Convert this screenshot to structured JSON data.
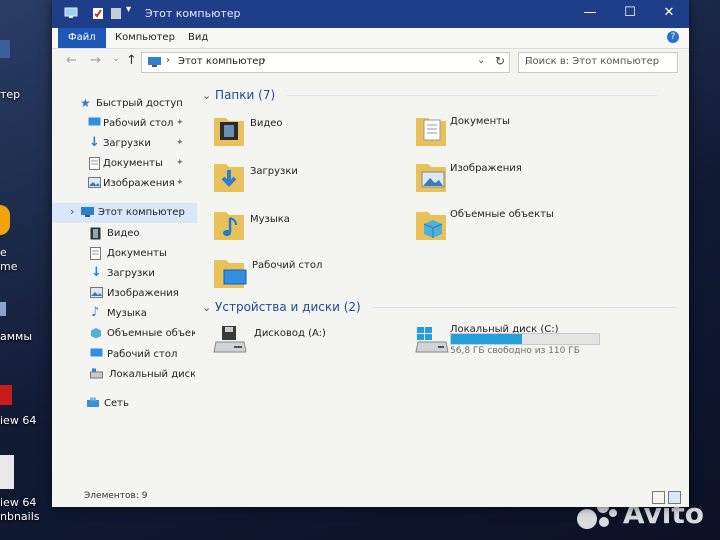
{
  "window": {
    "title": "Этот компьютер",
    "ribbon_tabs": [
      "Файл",
      "Компьютер",
      "Вид"
    ],
    "help": "?",
    "controls": {
      "minimize": "—",
      "maximize": "☐",
      "close": "✕"
    }
  },
  "toolbar": {
    "back": "←",
    "forward": "→",
    "history": "⌄",
    "up": "↑",
    "address": "Этот компьютер",
    "address_sep": "›",
    "address_dropdown": "⌄",
    "refresh": "↻",
    "search_placeholder": "Поиск в: Этот компьютер",
    "search_icon": "⌕"
  },
  "nav": {
    "quick_access": "Быстрый доступ",
    "quick_items": [
      "Рабочий стол",
      "Загрузки",
      "Документы",
      "Изображения"
    ],
    "this_pc": "Этот компьютер",
    "pc_items": [
      "Видео",
      "Документы",
      "Загрузки",
      "Изображения",
      "Музыка",
      "Объемные объекты",
      "Рабочий стол",
      "Локальный диск (C"
    ],
    "network": "Сеть",
    "chevron_collapsed": "›",
    "pin_glyph": "✦"
  },
  "content": {
    "folders_header": "Папки (7)",
    "folders": [
      "Видео",
      "Документы",
      "Загрузки",
      "Изображения",
      "Музыка",
      "Объемные объекты",
      "Рабочий стол"
    ],
    "devices_header": "Устройства и диски (2)",
    "group_chevron": "⌄",
    "floppy": "Дисковод (A:)",
    "local_disk": {
      "name": "Локальный диск (C:)",
      "free_text": "56,8 ГБ свободно из 110 ГБ",
      "used_fraction": 0.48
    }
  },
  "status": {
    "items_count": "Элементов: 9"
  },
  "desktop": {
    "labels": [
      "тер",
      "e",
      "me",
      "аммы",
      "iew 64",
      "iew 64",
      "nbnails"
    ],
    "watermark": "Avito"
  },
  "colors": {
    "titlebar": "#1f3e8a",
    "ribbon_active": "#1e57b5",
    "selection": "#d9e8f8",
    "progress": "#26a0da",
    "folder": "#e8c15a",
    "header_text": "#1f4a98"
  }
}
